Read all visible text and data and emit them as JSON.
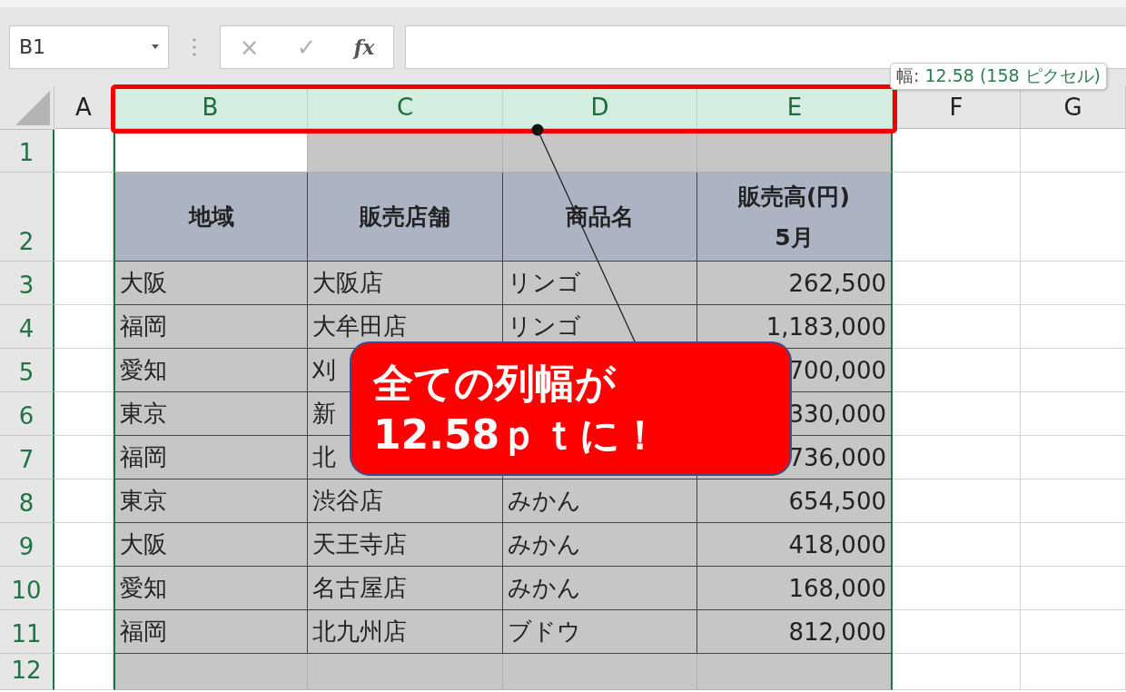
{
  "name_box": {
    "value": "B1"
  },
  "formula_buttons": [
    "×",
    "✓",
    "fx"
  ],
  "columns": [
    {
      "letter": "A",
      "selected": false
    },
    {
      "letter": "B",
      "selected": true
    },
    {
      "letter": "C",
      "selected": true
    },
    {
      "letter": "D",
      "selected": true
    },
    {
      "letter": "E",
      "selected": true
    },
    {
      "letter": "F",
      "selected": false
    },
    {
      "letter": "G",
      "selected": false
    }
  ],
  "width_tooltip": {
    "label": "幅:",
    "value": "12.58 (158 ピクセル)"
  },
  "rows": [
    {
      "number": "1",
      "kind": "blank",
      "active": true
    },
    {
      "number": "2",
      "kind": "header",
      "active": false,
      "region": "地域",
      "store": "販売店舗",
      "product": "商品名",
      "sales": "販売高(円)\n5月"
    },
    {
      "number": "3",
      "kind": "data",
      "active": false,
      "region": "大阪",
      "store": "大阪店",
      "product": "リンゴ",
      "sales": "262,500"
    },
    {
      "number": "4",
      "kind": "data",
      "active": false,
      "region": "福岡",
      "store": "大牟田店",
      "product": "リンゴ",
      "sales": "1,183,000"
    },
    {
      "number": "5",
      "kind": "data",
      "active": false,
      "region": "愛知",
      "store": "刈",
      "sales": "700,000"
    },
    {
      "number": "6",
      "kind": "data",
      "active": false,
      "region": "東京",
      "store": "新",
      "sales": "330,000"
    },
    {
      "number": "7",
      "kind": "data",
      "active": false,
      "region": "福岡",
      "store": "北",
      "sales": "736,000"
    },
    {
      "number": "8",
      "kind": "data",
      "active": false,
      "region": "東京",
      "store": "渋谷店",
      "product": "みかん",
      "sales": "654,500"
    },
    {
      "number": "9",
      "kind": "data",
      "active": false,
      "region": "大阪",
      "store": "天王寺店",
      "product": "みかん",
      "sales": "418,000"
    },
    {
      "number": "10",
      "kind": "data",
      "active": false,
      "region": "愛知",
      "store": "名古屋店",
      "product": "みかん",
      "sales": "168,000"
    },
    {
      "number": "11",
      "kind": "data",
      "active": false,
      "region": "福岡",
      "store": "北九州店",
      "product": "ブドウ",
      "sales": "812,000"
    },
    {
      "number": "12",
      "kind": "blank",
      "active": false
    }
  ],
  "callout": {
    "lines": [
      "全ての列幅が",
      "12.58ｐｔに！"
    ]
  }
}
